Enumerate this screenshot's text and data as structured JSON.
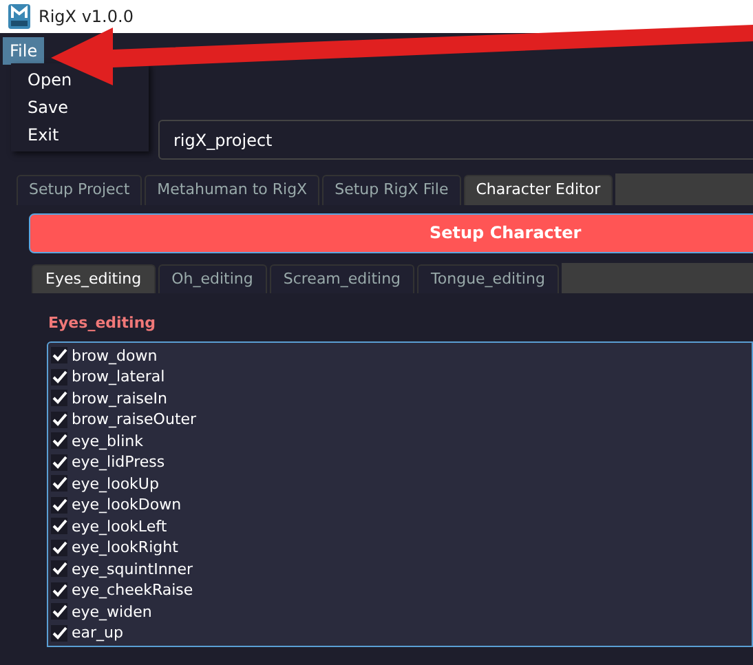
{
  "window": {
    "title": "RigX v1.0.0"
  },
  "menu_bar": [
    {
      "label": "File",
      "selected": true
    }
  ],
  "menu": {
    "items": [
      "Open",
      "Save",
      "Exit"
    ]
  },
  "project": {
    "value": "rigX_project"
  },
  "tabs": [
    {
      "label": "Setup Project",
      "selected": false
    },
    {
      "label": "Metahuman to RigX",
      "selected": false
    },
    {
      "label": "Setup RigX File",
      "selected": false
    },
    {
      "label": "Character Editor",
      "selected": true
    }
  ],
  "setup_button": "Setup Character",
  "sub_tabs": [
    {
      "label": "Eyes_editing",
      "selected": true
    },
    {
      "label": "Oh_editing",
      "selected": false
    },
    {
      "label": "Scream_editing",
      "selected": false
    },
    {
      "label": "Tongue_editing",
      "selected": false
    }
  ],
  "group_title": "Eyes_editing",
  "controls": [
    {
      "label": "brow_down",
      "checked": true
    },
    {
      "label": "brow_lateral",
      "checked": true
    },
    {
      "label": "brow_raiseIn",
      "checked": true
    },
    {
      "label": "brow_raiseOuter",
      "checked": true
    },
    {
      "label": "eye_blink",
      "checked": true
    },
    {
      "label": "eye_lidPress",
      "checked": true
    },
    {
      "label": "eye_lookUp",
      "checked": true
    },
    {
      "label": "eye_lookDown",
      "checked": true
    },
    {
      "label": "eye_lookLeft",
      "checked": true
    },
    {
      "label": "eye_lookRight",
      "checked": true
    },
    {
      "label": "eye_squintInner",
      "checked": true
    },
    {
      "label": "eye_cheekRaise",
      "checked": true
    },
    {
      "label": "eye_widen",
      "checked": true
    },
    {
      "label": "ear_up",
      "checked": true
    }
  ]
}
